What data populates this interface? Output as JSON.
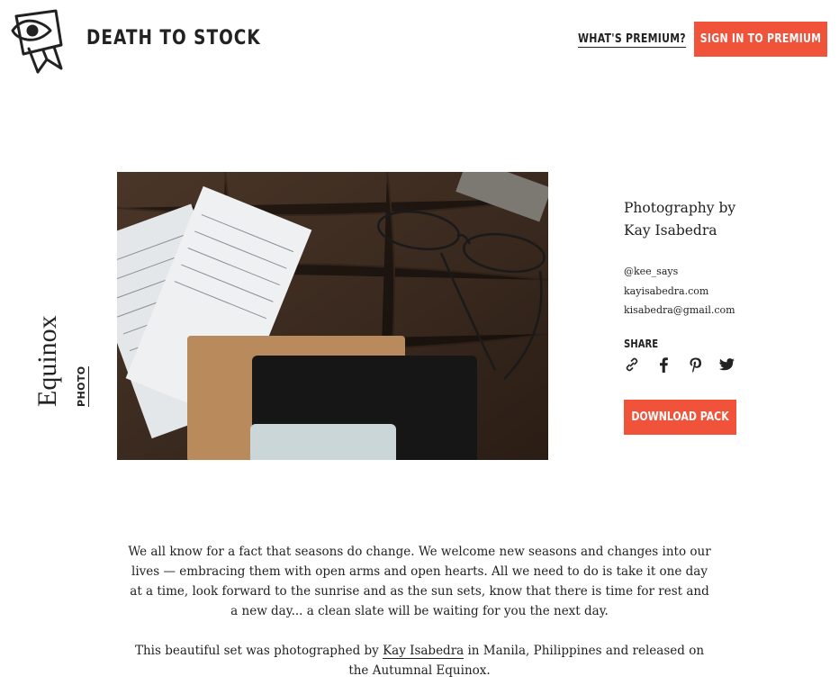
{
  "header": {
    "brand": "DEATH TO STOCK",
    "premium_link": "WHAT'S PREMIUM?",
    "signin_button": "SIGN IN TO PREMIUM"
  },
  "pack": {
    "title": "Equinox",
    "type_tag": "PHOTO"
  },
  "sidebar": {
    "credit_line1": "Photography by",
    "credit_line2": "Kay Isabedra",
    "handle": "@kee_says",
    "website": "kayisabedra.com",
    "email": "kisabedra@gmail.com",
    "share_label": "SHARE",
    "share_icons": [
      "link-icon",
      "facebook-icon",
      "pinterest-icon",
      "twitter-icon"
    ],
    "download_button": "DOWNLOAD PACK"
  },
  "description": {
    "paragraph1": "We all know for a fact that seasons do change. We welcome new seasons and changes into our lives — embracing them with open arms and open hearts. All we need to do is take it one day at a time, look forward to the sunrise and as the sun sets, know that there is time for rest and a new day... a clean slate will be waiting for you the next day.",
    "p2_before": "This beautiful set was photographed by ",
    "p2_link": "Kay Isabedra",
    "p2_after": " in Manila, Philippines and released on the Autumnal Equinox."
  },
  "colors": {
    "accent": "#f0533a",
    "text": "#222222"
  }
}
